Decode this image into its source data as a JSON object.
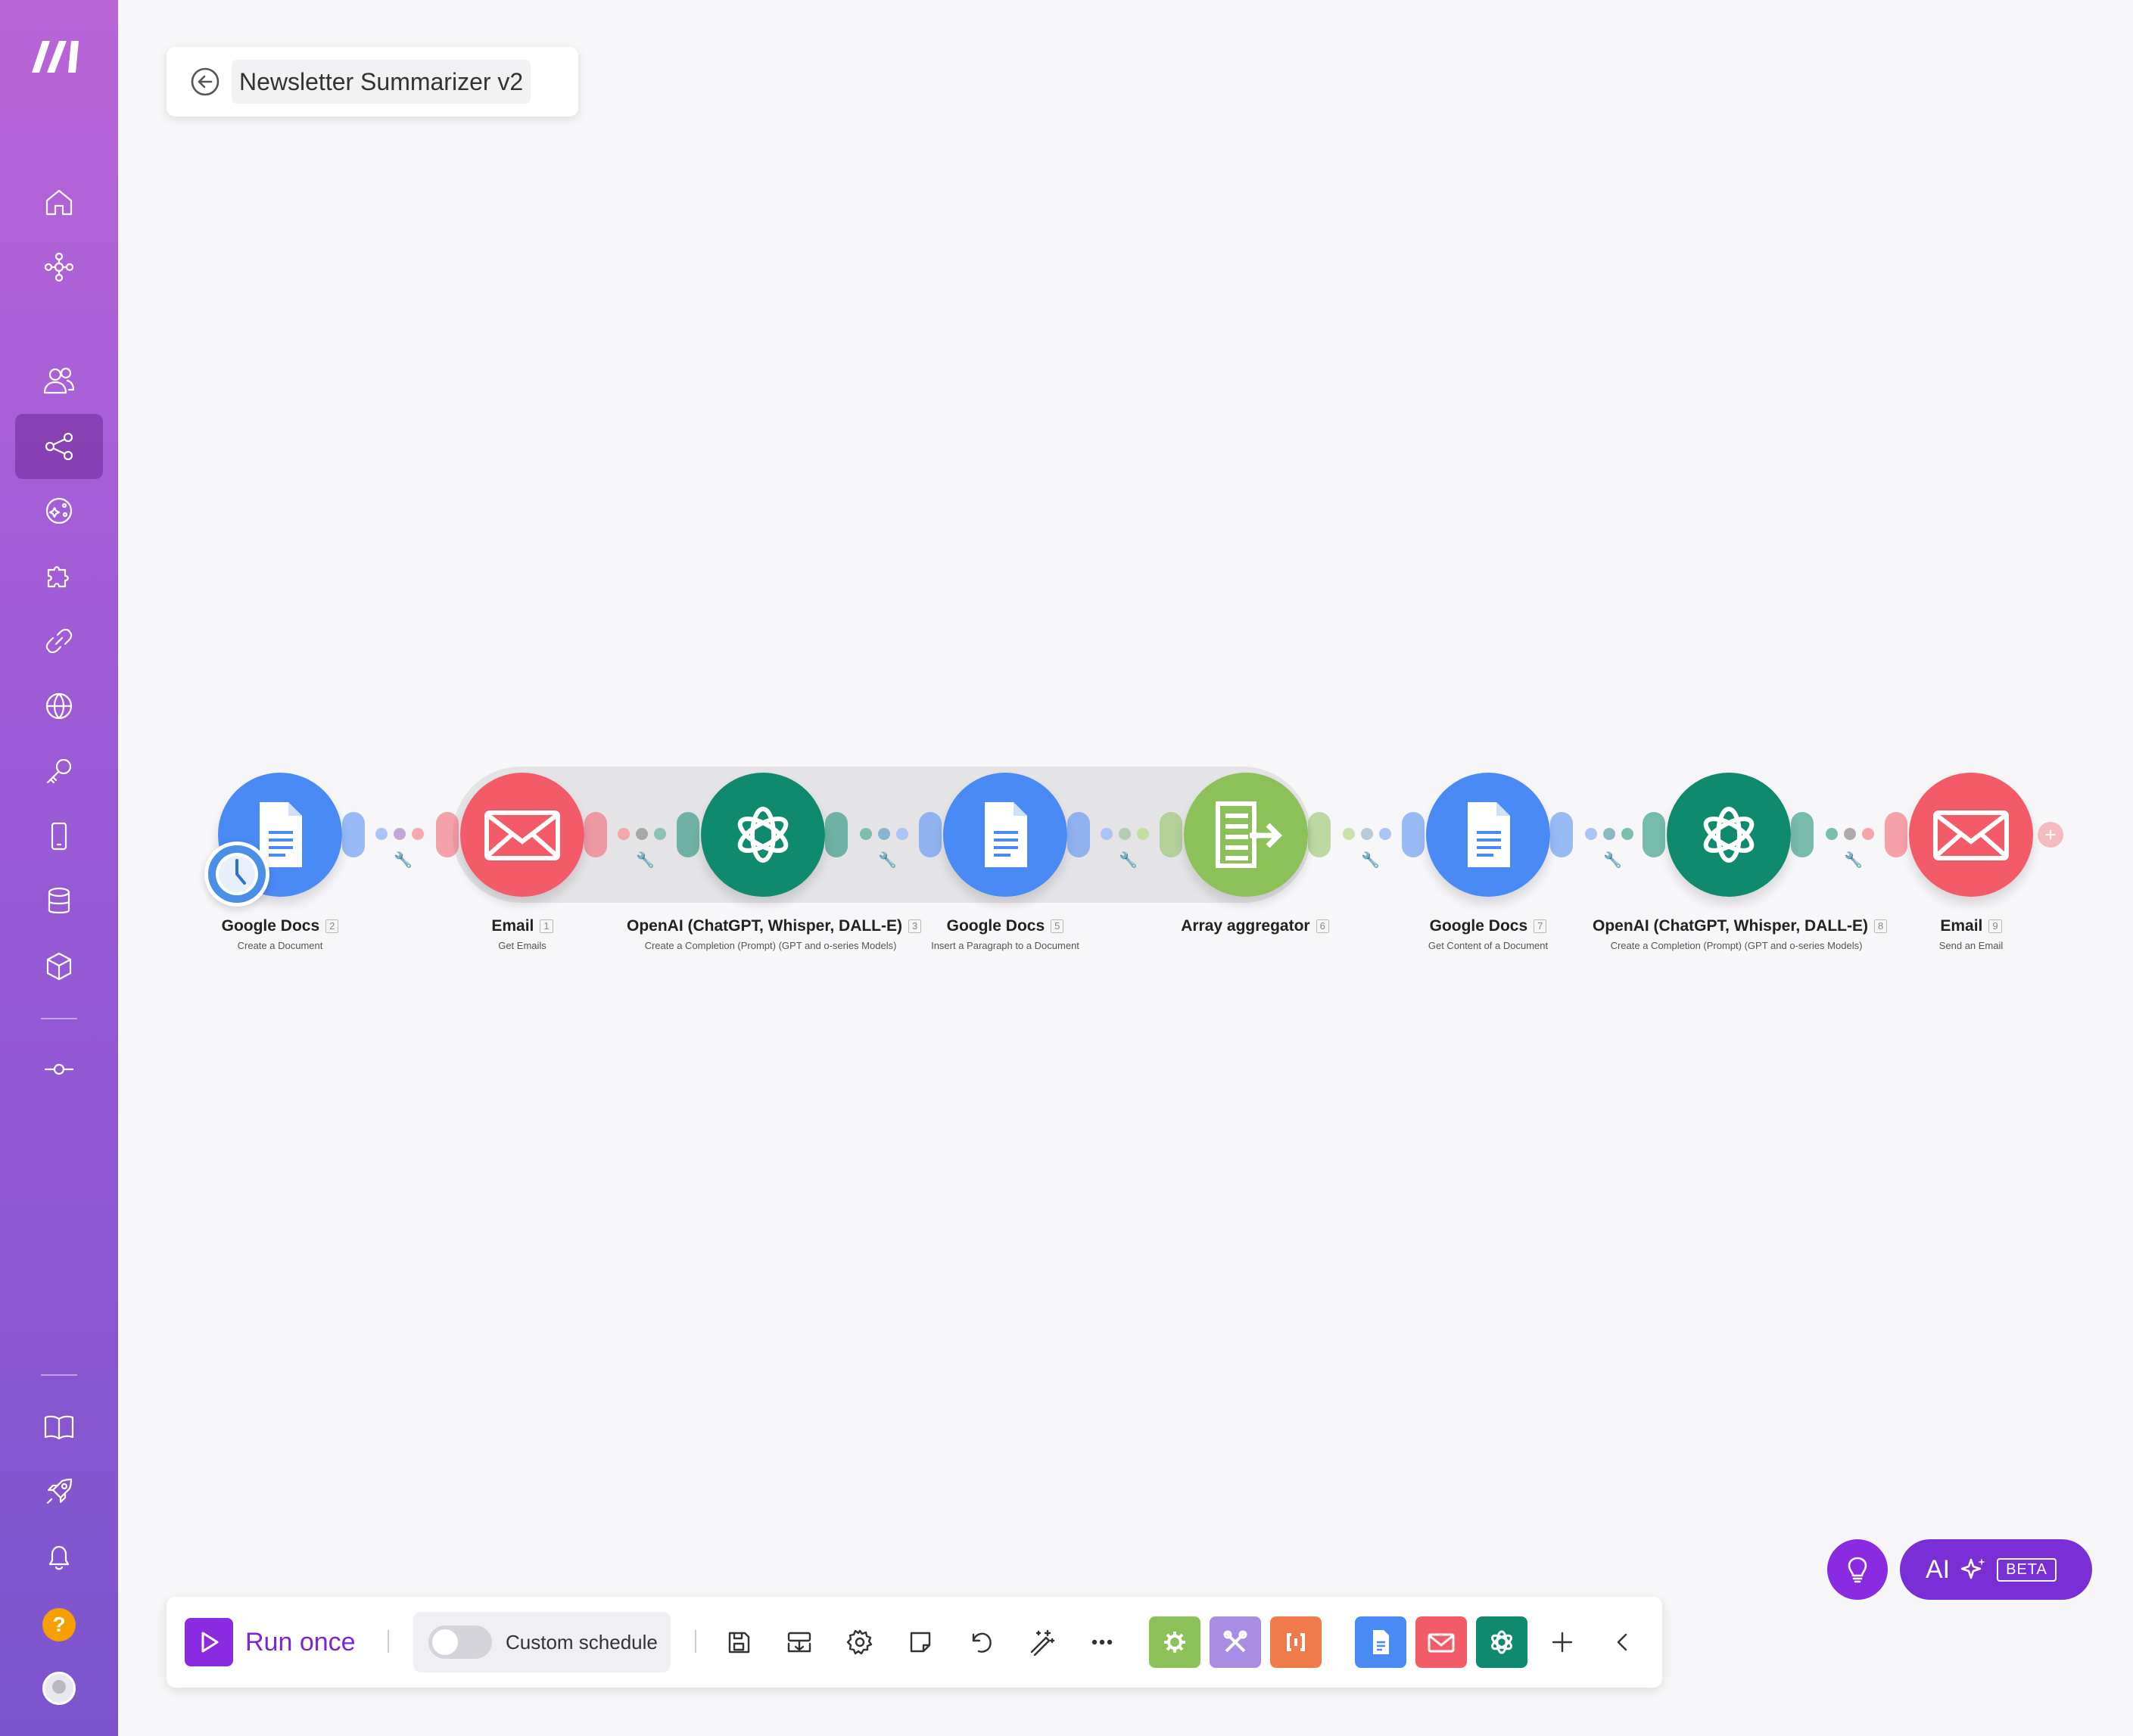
{
  "scenario": {
    "title": "Newsletter Summarizer v2"
  },
  "sidebar": {
    "items": [
      {
        "icon": "home-icon"
      },
      {
        "icon": "organization-icon"
      },
      {
        "icon": "team-icon"
      },
      {
        "icon": "scenarios-icon",
        "active": true
      },
      {
        "icon": "ai-agents-icon"
      },
      {
        "icon": "templates-icon"
      },
      {
        "icon": "connections-icon"
      },
      {
        "icon": "webhooks-icon"
      },
      {
        "icon": "keys-icon"
      },
      {
        "icon": "devices-icon"
      },
      {
        "icon": "data-stores-icon"
      },
      {
        "icon": "data-structures-icon"
      },
      {
        "icon": "more-icon"
      },
      {
        "icon": "help-center-icon"
      },
      {
        "icon": "whats-new-icon"
      },
      {
        "icon": "notifications-icon"
      }
    ],
    "help_label": "?"
  },
  "modules": [
    {
      "app": "Google Docs",
      "num": "2",
      "action": "Create a Document",
      "color": "#4a8af4"
    },
    {
      "app": "Email",
      "num": "1",
      "action": "Get Emails",
      "color": "#f45b69"
    },
    {
      "app": "OpenAI (ChatGPT, Whisper, DALL-E)",
      "num": "3",
      "action": "Create a Completion (Prompt) (GPT and o-series Models)",
      "color": "#0f8a6f"
    },
    {
      "app": "Google Docs",
      "num": "5",
      "action": "Insert a Paragraph to a Document",
      "color": "#4a8af4"
    },
    {
      "app": "Array aggregator",
      "num": "6",
      "action": "",
      "color": "#8cc15a"
    },
    {
      "app": "Google Docs",
      "num": "7",
      "action": "Get Content of a Document",
      "color": "#4a8af4"
    },
    {
      "app": "OpenAI (ChatGPT, Whisper, DALL-E)",
      "num": "8",
      "action": "Create a Completion (Prompt) (GPT and o-series Models)",
      "color": "#0f8a6f"
    },
    {
      "app": "Email",
      "num": "9",
      "action": "Send an Email",
      "color": "#f45b69"
    }
  ],
  "toolbar": {
    "run_label": "Run once",
    "schedule_label": "Custom schedule",
    "tools": [
      "save-icon",
      "import-export-icon",
      "settings-icon",
      "notes-icon",
      "undo-icon",
      "auto-align-icon",
      "more-icon"
    ],
    "favorites": [
      "flow-control",
      "tools",
      "json",
      "google-docs",
      "email",
      "openai"
    ]
  },
  "ai": {
    "label": "AI",
    "badge": "BETA"
  }
}
